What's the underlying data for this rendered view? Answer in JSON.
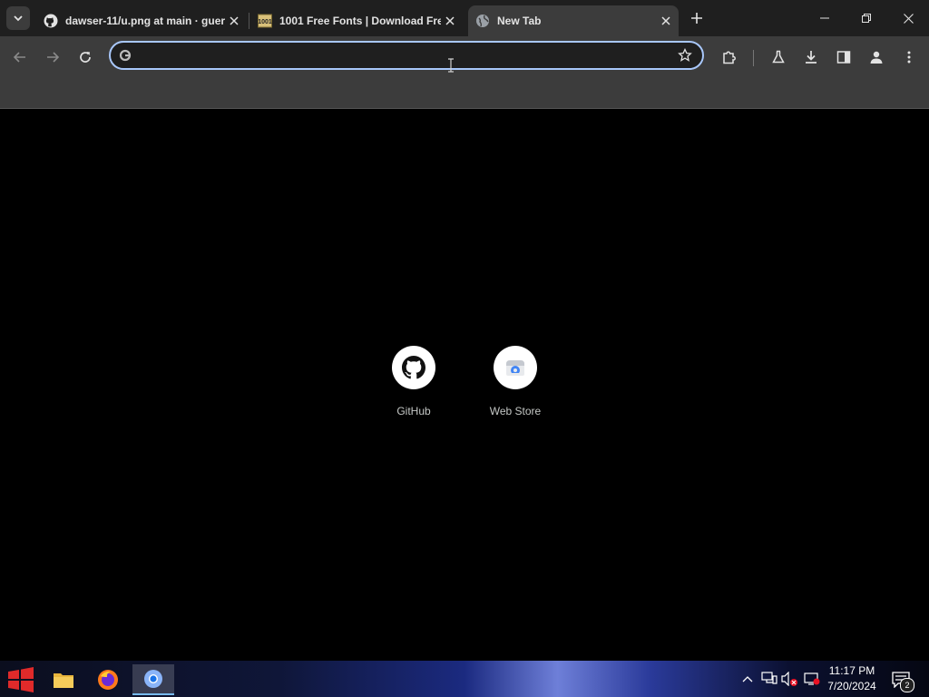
{
  "tabs": [
    {
      "title": "dawser-11/u.png at main · guer",
      "favicon": "github-icon"
    },
    {
      "title": "1001 Free Fonts | Download Fre",
      "favicon": "fonts-site-icon"
    },
    {
      "title": "New Tab",
      "favicon": "globe-icon",
      "active": true
    }
  ],
  "omnibox": {
    "value": "",
    "placeholder": ""
  },
  "shortcuts": [
    {
      "label": "GitHub",
      "icon": "github-icon"
    },
    {
      "label": "Web Store",
      "icon": "web-store-icon"
    }
  ],
  "clock": {
    "time": "11:17 PM",
    "date": "7/20/2024"
  },
  "notifications": {
    "count": "2"
  },
  "colors": {
    "accent": "#a8c7fa",
    "tab_bar": "#1f1f1f",
    "toolbar": "#3c3c3c",
    "page": "#000000"
  }
}
